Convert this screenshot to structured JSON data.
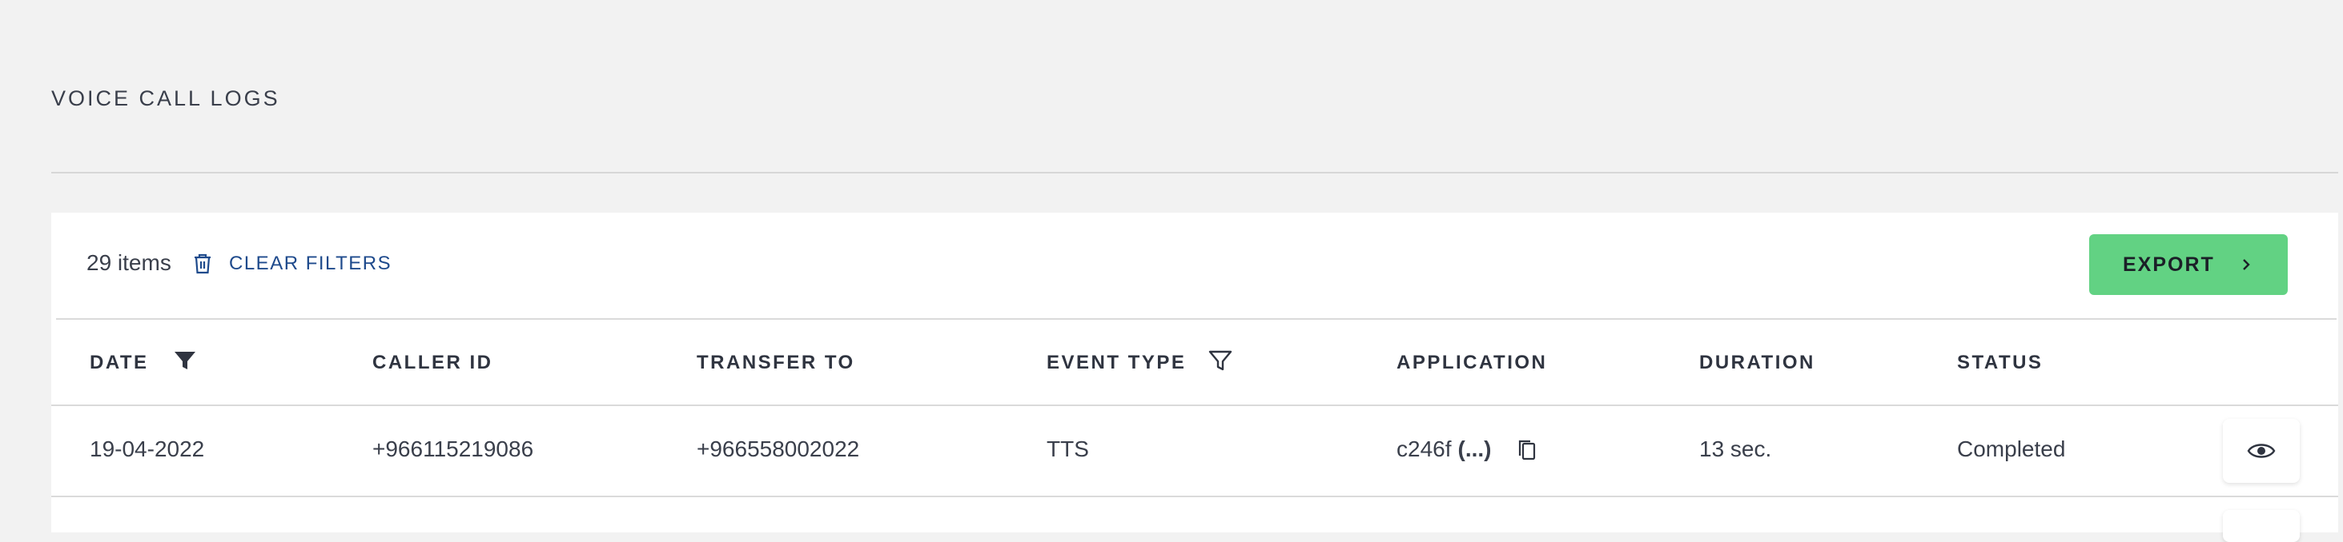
{
  "page": {
    "title": "VOICE CALL LOGS"
  },
  "toolbar": {
    "items_count": "29 items",
    "clear_filters_label": "CLEAR FILTERS",
    "export_label": "EXPORT",
    "icons": {
      "clear": "trash-icon",
      "export": "chevron-right-icon"
    }
  },
  "table": {
    "columns": [
      {
        "label": "DATE",
        "filterable": true,
        "filter_active": true
      },
      {
        "label": "CALLER ID",
        "filterable": false
      },
      {
        "label": "TRANSFER TO",
        "filterable": false
      },
      {
        "label": "EVENT TYPE",
        "filterable": true,
        "filter_active": false
      },
      {
        "label": "APPLICATION",
        "filterable": false
      },
      {
        "label": "DURATION",
        "filterable": false
      },
      {
        "label": "STATUS",
        "filterable": false
      }
    ],
    "rows": [
      {
        "date": "19-04-2022",
        "caller_id": "+966115219086",
        "transfer_to": "+966558002022",
        "event_type": "TTS",
        "application": "c246f",
        "application_more": "(...)",
        "duration": "13 sec.",
        "status": "Completed"
      }
    ]
  },
  "colors": {
    "background": "#f2f2f2",
    "card": "#ffffff",
    "accent_button": "#62d283",
    "link": "#1e4a8c",
    "text": "#3a3f4b"
  }
}
